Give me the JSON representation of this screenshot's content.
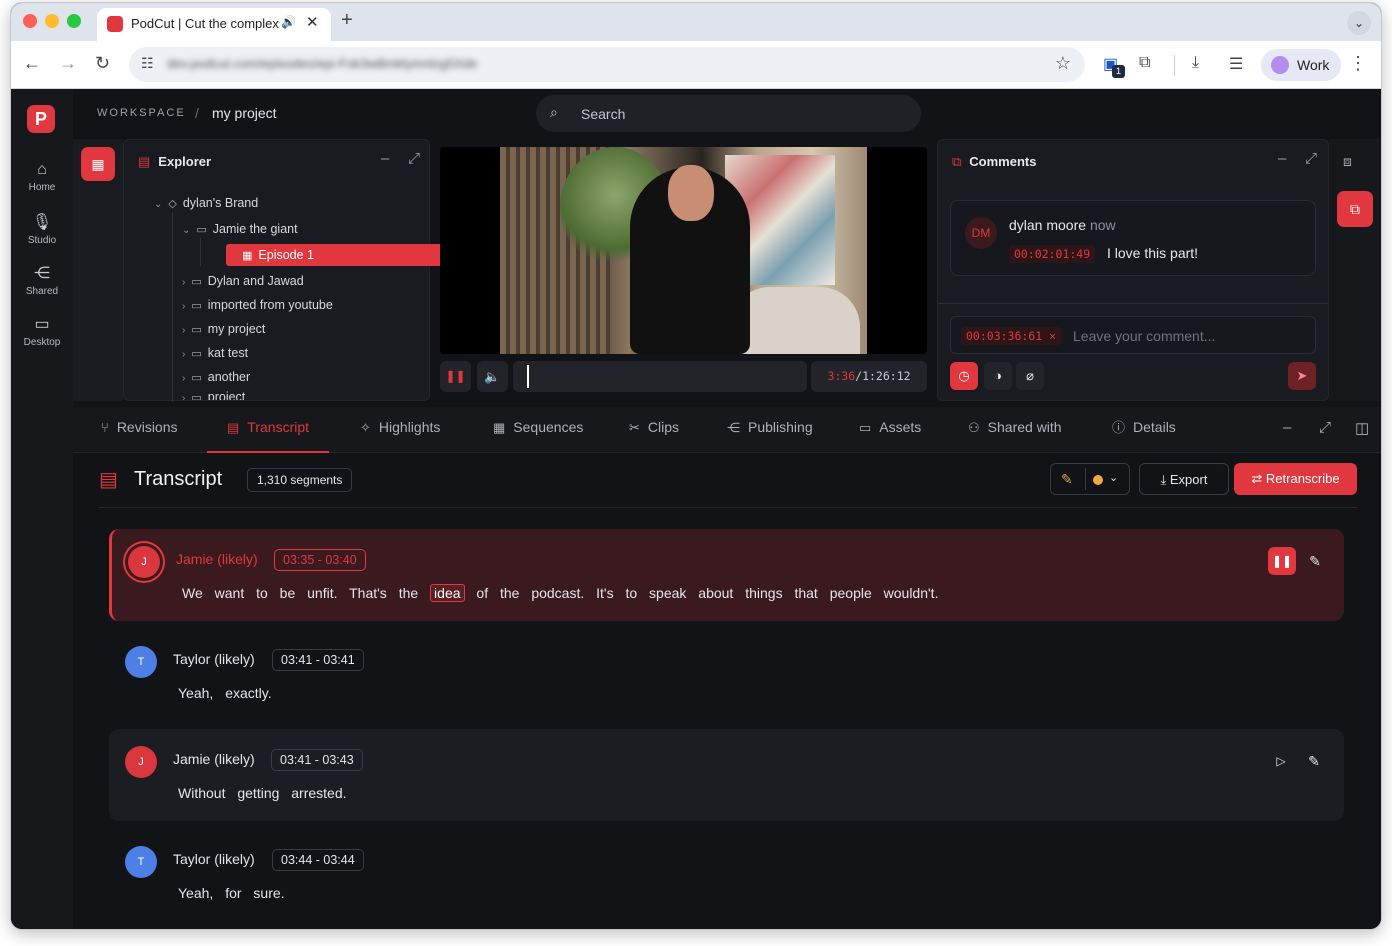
{
  "browser": {
    "tab_title": "PodCut | Cut the complex",
    "new_tab": "+",
    "url": "dev.podcut.com/episodes/epi-Fok3wBmklymnlzg5Xde",
    "profile_label": "Work",
    "extension_badge": "1"
  },
  "app": {
    "breadcrumb": {
      "workspace": "WORKSPACE",
      "separator": "/",
      "project": "my project"
    },
    "search_placeholder": "Search",
    "nav": [
      {
        "label": "Home",
        "icon": "home-icon"
      },
      {
        "label": "Studio",
        "icon": "mic-icon"
      },
      {
        "label": "Shared",
        "icon": "share-icon"
      },
      {
        "label": "Desktop",
        "icon": "desktop-icon"
      }
    ],
    "explorer": {
      "title": "Explorer",
      "tree": [
        {
          "label": "dylan's Brand",
          "level": 0,
          "expanded": true,
          "kind": "tag"
        },
        {
          "label": "Jamie the giant",
          "level": 1,
          "expanded": true,
          "kind": "folder"
        },
        {
          "label": "Episode 1",
          "level": 2,
          "selected": true,
          "kind": "episode"
        },
        {
          "label": "Dylan and Jawad",
          "level": 1,
          "kind": "folder"
        },
        {
          "label": "imported from youtube",
          "level": 1,
          "kind": "folder"
        },
        {
          "label": "my project",
          "level": 1,
          "kind": "folder"
        },
        {
          "label": "kat test",
          "level": 1,
          "kind": "folder"
        },
        {
          "label": "another",
          "level": 1,
          "kind": "folder"
        },
        {
          "label": "project",
          "level": 1,
          "kind": "folder"
        }
      ]
    },
    "player": {
      "current_time": "3:36",
      "duration": "/1:26:12",
      "progress": 0.041
    },
    "comments": {
      "title": "Comments",
      "items": [
        {
          "initials": "DM",
          "author": "dylan moore",
          "when": "now",
          "timecode": "00:02:01:49",
          "text": "I love this part!"
        }
      ],
      "input_timecode": "00:03:36:61",
      "input_timecode_clear": "×",
      "input_placeholder": "Leave your comment..."
    },
    "tabs": [
      {
        "label": "Revisions",
        "icon": "revisions-icon"
      },
      {
        "label": "Transcript",
        "icon": "document-icon",
        "active": true
      },
      {
        "label": "Highlights",
        "icon": "sparkle-icon"
      },
      {
        "label": "Sequences",
        "icon": "film-icon"
      },
      {
        "label": "Clips",
        "icon": "scissors-icon"
      },
      {
        "label": "Publishing",
        "icon": "share-icon"
      },
      {
        "label": "Assets",
        "icon": "folder-icon"
      },
      {
        "label": "Shared with",
        "icon": "users-icon"
      },
      {
        "label": "Details",
        "icon": "info-icon"
      }
    ],
    "transcript": {
      "title": "Transcript",
      "segments_badge": "1,310 segments",
      "export_label": "Export",
      "retranscribe_label": "Retranscribe",
      "status_color": "#f2a93b",
      "segments": [
        {
          "initial": "J",
          "speaker": "Jamie (likely)",
          "range": "03:35 - 03:40",
          "words_before": "We want to be unfit. That's the",
          "highlight": "idea",
          "words_after": "of the podcast. It's to speak about things that people wouldn't.",
          "active": true
        },
        {
          "initial": "T",
          "speaker": "Taylor (likely)",
          "range": "03:41 - 03:41",
          "text": "Yeah, exactly."
        },
        {
          "initial": "J",
          "speaker": "Jamie (likely)",
          "range": "03:41 - 03:43",
          "text": "Without getting arrested."
        },
        {
          "initial": "T",
          "speaker": "Taylor (likely)",
          "range": "03:44 - 03:44",
          "text": "Yeah, for sure."
        }
      ]
    },
    "colors": {
      "accent": "#e0383e",
      "background": "#121317",
      "panel": "#1a1b20"
    }
  }
}
